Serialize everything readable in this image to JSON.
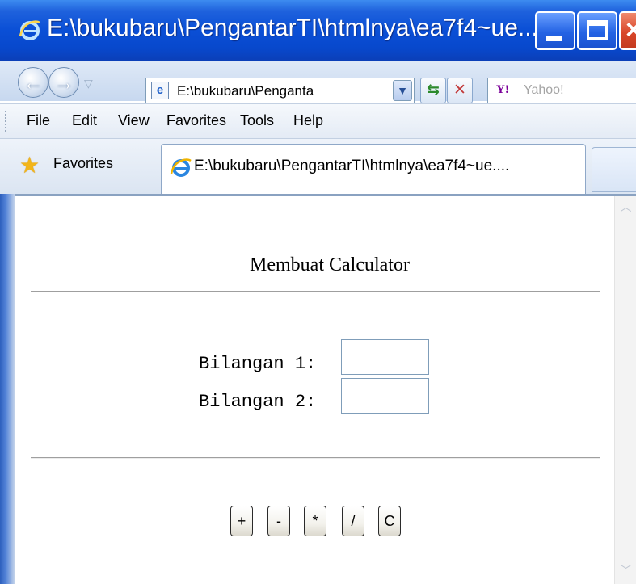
{
  "window": {
    "title": "E:\\bukubaru\\PengantarTI\\htmlnya\\ea7f4~ue...."
  },
  "addressbar": {
    "back_icon": "arrow-left-icon",
    "forward_icon": "arrow-right-icon",
    "url": "E:\\bukubaru\\Penganta",
    "search_placeholder": "Yahoo!",
    "search_provider_logo": "Y!"
  },
  "menu": {
    "items": [
      "File",
      "Edit",
      "View",
      "Favorites",
      "Tools",
      "Help"
    ]
  },
  "favorites": {
    "label": "Favorites"
  },
  "tab": {
    "label": "E:\\bukubaru\\PengantarTI\\htmlnya\\ea7f4~ue...."
  },
  "page": {
    "heading": "Membuat Calculator",
    "fields": [
      {
        "label": "Bilangan 1:",
        "value": ""
      },
      {
        "label": "Bilangan 2:",
        "value": ""
      }
    ],
    "buttons": [
      "+",
      "-",
      "*",
      "/",
      "C"
    ]
  },
  "colors": {
    "titlebar": "#0a4fd6",
    "close_button": "#d9472a",
    "favorites_star": "#f2b51a"
  }
}
